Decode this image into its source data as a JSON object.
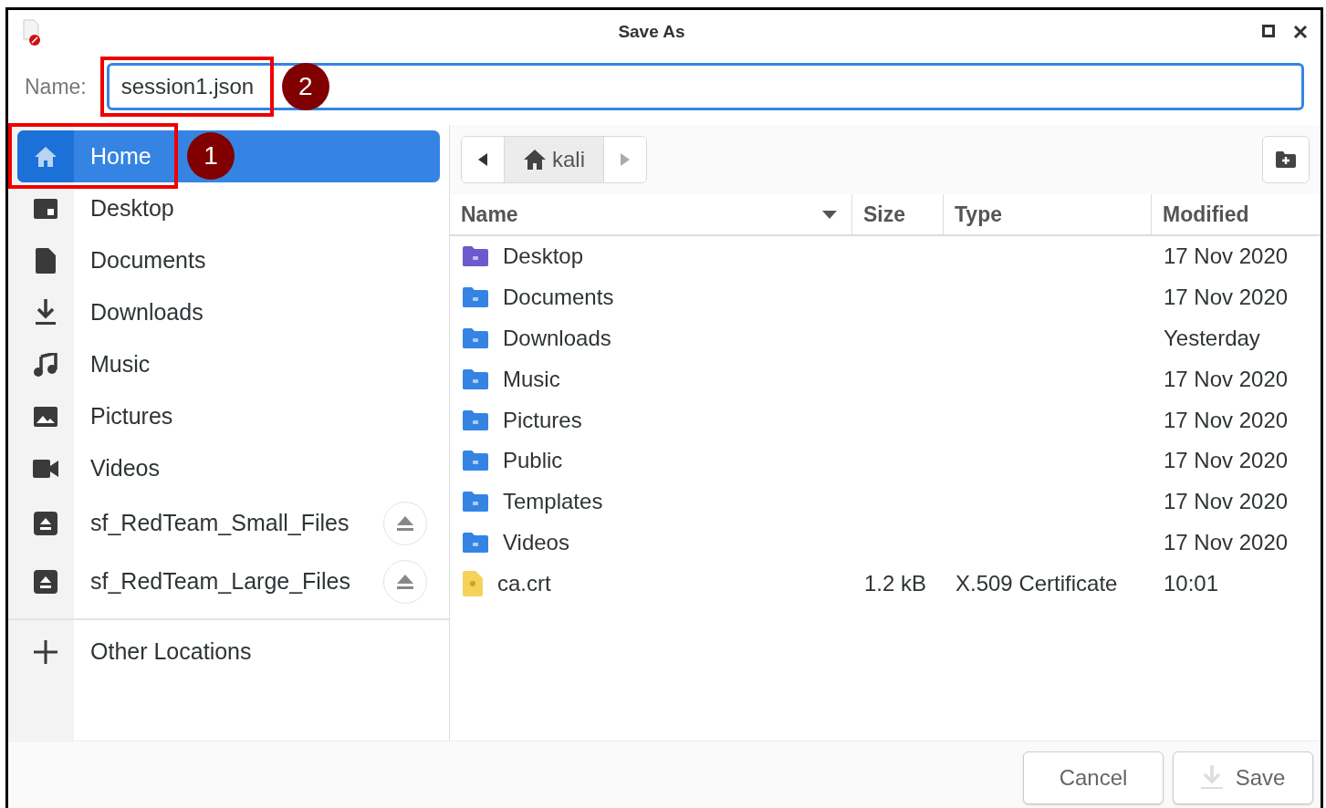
{
  "window": {
    "title": "Save As"
  },
  "name_field": {
    "label": "Name:",
    "value": "session1.json",
    "callout": "2"
  },
  "sidebar": {
    "items": [
      {
        "label": "Home",
        "kind": "home",
        "selected": true,
        "callout": "1"
      },
      {
        "label": "Desktop",
        "kind": "desktop",
        "selected": false
      },
      {
        "label": "Documents",
        "kind": "documents",
        "selected": false
      },
      {
        "label": "Downloads",
        "kind": "downloads",
        "selected": false
      },
      {
        "label": "Music",
        "kind": "music",
        "selected": false
      },
      {
        "label": "Pictures",
        "kind": "pictures",
        "selected": false
      },
      {
        "label": "Videos",
        "kind": "videos",
        "selected": false
      },
      {
        "label": "sf_RedTeam_Small_Files",
        "kind": "drive",
        "selected": false,
        "ejectable": true
      },
      {
        "label": "sf_RedTeam_Large_Files",
        "kind": "drive",
        "selected": false,
        "ejectable": true
      }
    ],
    "other": {
      "label": "Other Locations"
    }
  },
  "path_bar": {
    "segments": [
      {
        "label": "kali",
        "kind": "home"
      }
    ]
  },
  "table": {
    "columns": [
      {
        "label": "Name",
        "sorted": true
      },
      {
        "label": "Size",
        "sorted": false
      },
      {
        "label": "Type",
        "sorted": false
      },
      {
        "label": "Modified",
        "sorted": false
      }
    ],
    "rows": [
      {
        "kind": "folder",
        "color": "#6a5acd",
        "name": "Desktop",
        "modified": "17 Nov 2020"
      },
      {
        "kind": "folder",
        "color": "#3584e4",
        "name": "Documents",
        "modified": "17 Nov 2020"
      },
      {
        "kind": "folder",
        "color": "#3584e4",
        "name": "Downloads",
        "modified": "Yesterday"
      },
      {
        "kind": "folder",
        "color": "#3584e4",
        "name": "Music",
        "modified": "17 Nov 2020"
      },
      {
        "kind": "folder",
        "color": "#3584e4",
        "name": "Pictures",
        "modified": "17 Nov 2020"
      },
      {
        "kind": "folder",
        "color": "#3584e4",
        "name": "Public",
        "modified": "17 Nov 2020"
      },
      {
        "kind": "folder",
        "color": "#3584e4",
        "name": "Templates",
        "modified": "17 Nov 2020"
      },
      {
        "kind": "folder",
        "color": "#3584e4",
        "name": "Videos",
        "modified": "17 Nov 2020"
      },
      {
        "kind": "file",
        "color": "#f5d35a",
        "name": "ca.crt",
        "size": "1.2 kB",
        "type": "X.509 Certificate",
        "modified": "10:01"
      }
    ]
  },
  "buttons": [
    {
      "label": "Cancel",
      "kind": "cancel"
    },
    {
      "label": "Save",
      "kind": "save"
    }
  ]
}
